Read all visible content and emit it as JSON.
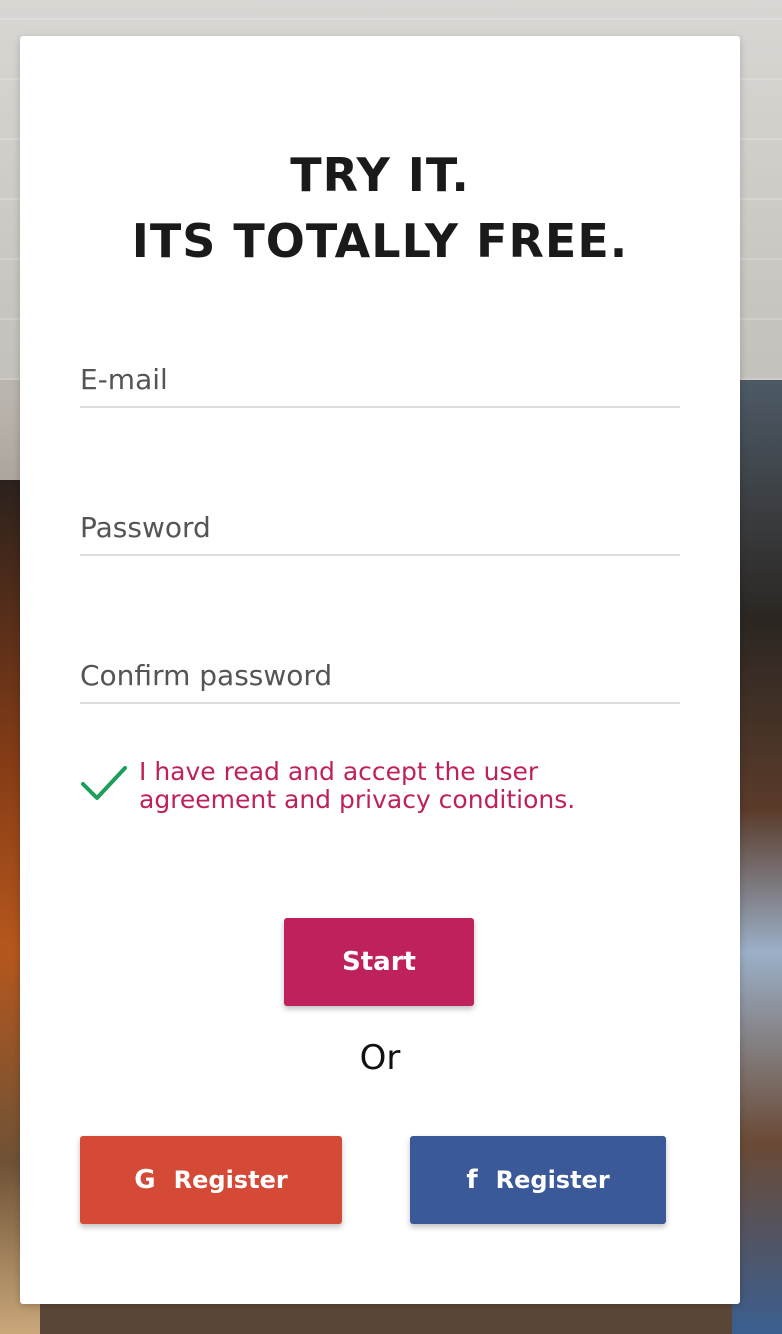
{
  "colors": {
    "accent": "#bf215c",
    "check": "#1e9e5a",
    "google": "#d44a36",
    "facebook": "#3b5998"
  },
  "form": {
    "title_line1": "TRY IT.",
    "title_line2": "ITS TOTALLY FREE.",
    "email_placeholder": "E-mail",
    "password_placeholder": "Password",
    "confirm_placeholder": "Confirm password",
    "agreement_text": "I have read and accept the user agreement and privacy conditions.",
    "agreement_checked": true,
    "start_label": "Start",
    "or_label": "Or",
    "google_icon": "G",
    "google_label": "Register",
    "facebook_icon": "f",
    "facebook_label": "Register"
  }
}
